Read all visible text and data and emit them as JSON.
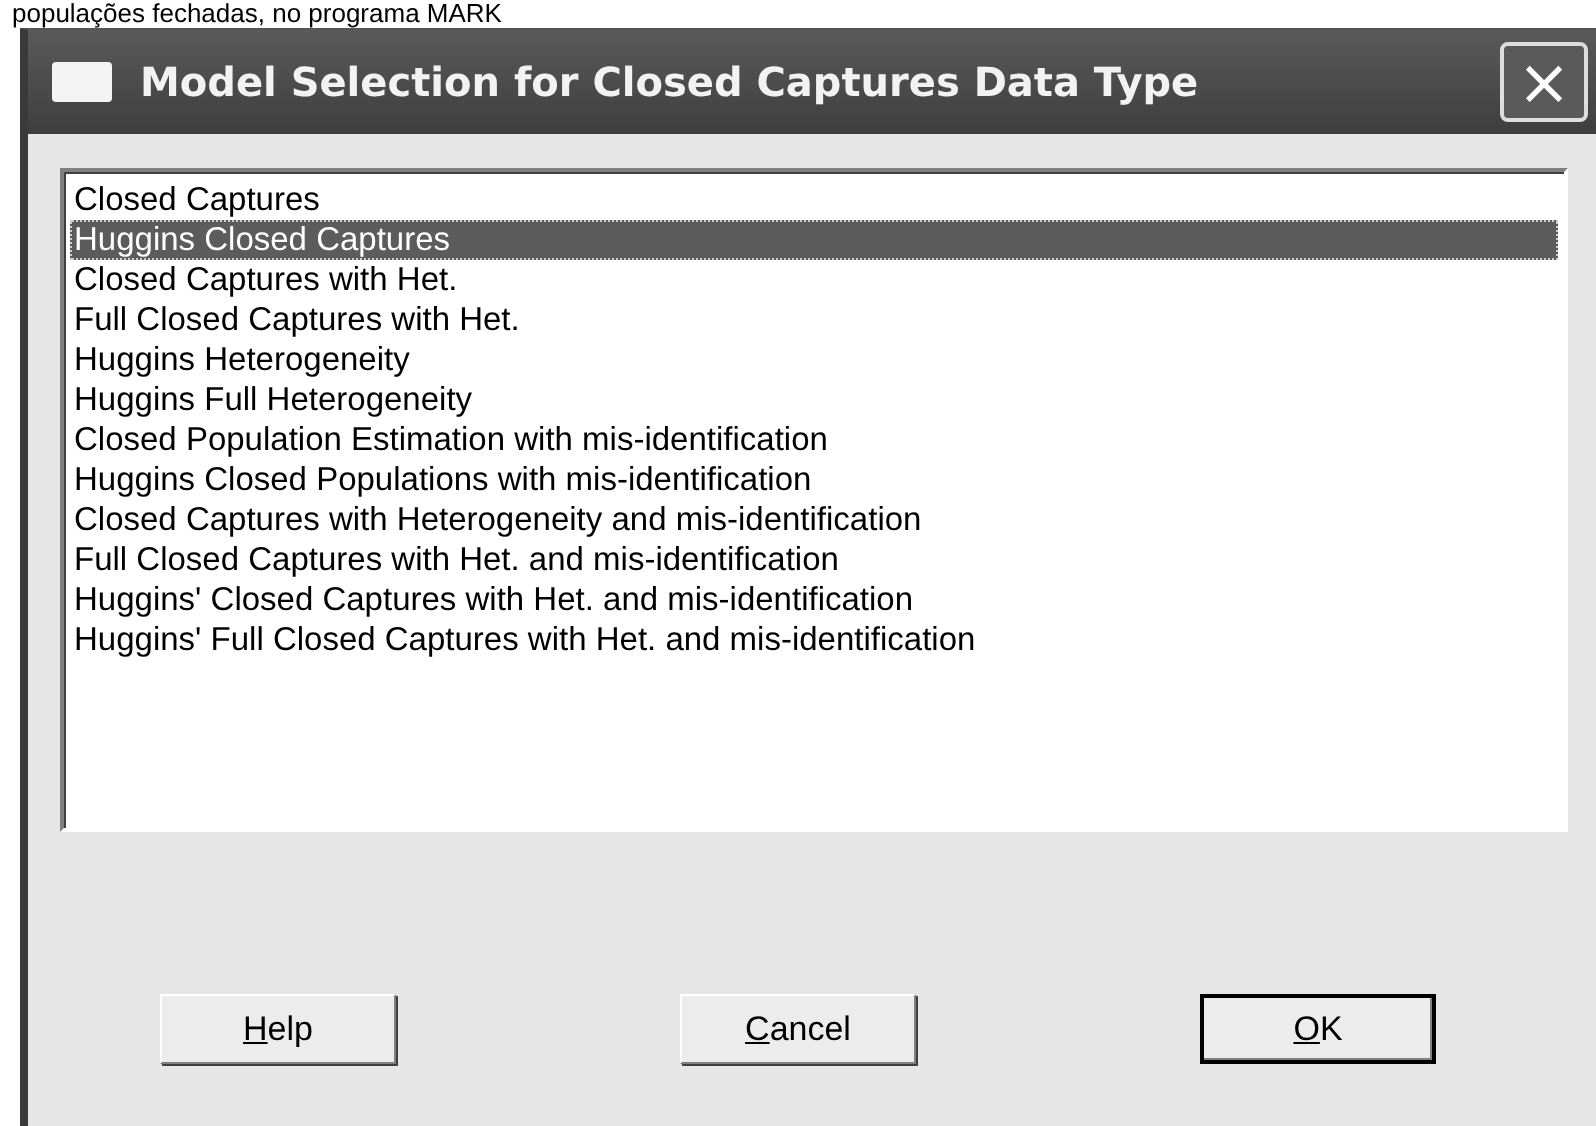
{
  "caption": "populações fechadas, no programa MARK",
  "window": {
    "title": "Model Selection for Closed Captures Data Type",
    "close": "×"
  },
  "list": {
    "items": [
      {
        "label": "Closed Captures",
        "selected": false
      },
      {
        "label": "Huggins Closed Captures",
        "selected": true
      },
      {
        "label": "Closed Captures with Het.",
        "selected": false
      },
      {
        "label": "Full Closed Captures with Het.",
        "selected": false
      },
      {
        "label": "Huggins Heterogeneity",
        "selected": false
      },
      {
        "label": "Huggins Full Heterogeneity",
        "selected": false
      },
      {
        "label": "Closed Population Estimation with mis-identification",
        "selected": false
      },
      {
        "label": "Huggins Closed Populations with mis-identification",
        "selected": false
      },
      {
        "label": "Closed Captures with Heterogeneity and mis-identification",
        "selected": false
      },
      {
        "label": "Full Closed Captures with Het. and mis-identification",
        "selected": false
      },
      {
        "label": "Huggins' Closed Captures with Het. and mis-identification",
        "selected": false
      },
      {
        "label": "Huggins' Full Closed Captures with Het. and mis-identification",
        "selected": false
      }
    ]
  },
  "buttons": [
    {
      "label": "Help",
      "default": false
    },
    {
      "label": "Cancel",
      "default": false
    },
    {
      "label": "OK",
      "default": true
    }
  ]
}
